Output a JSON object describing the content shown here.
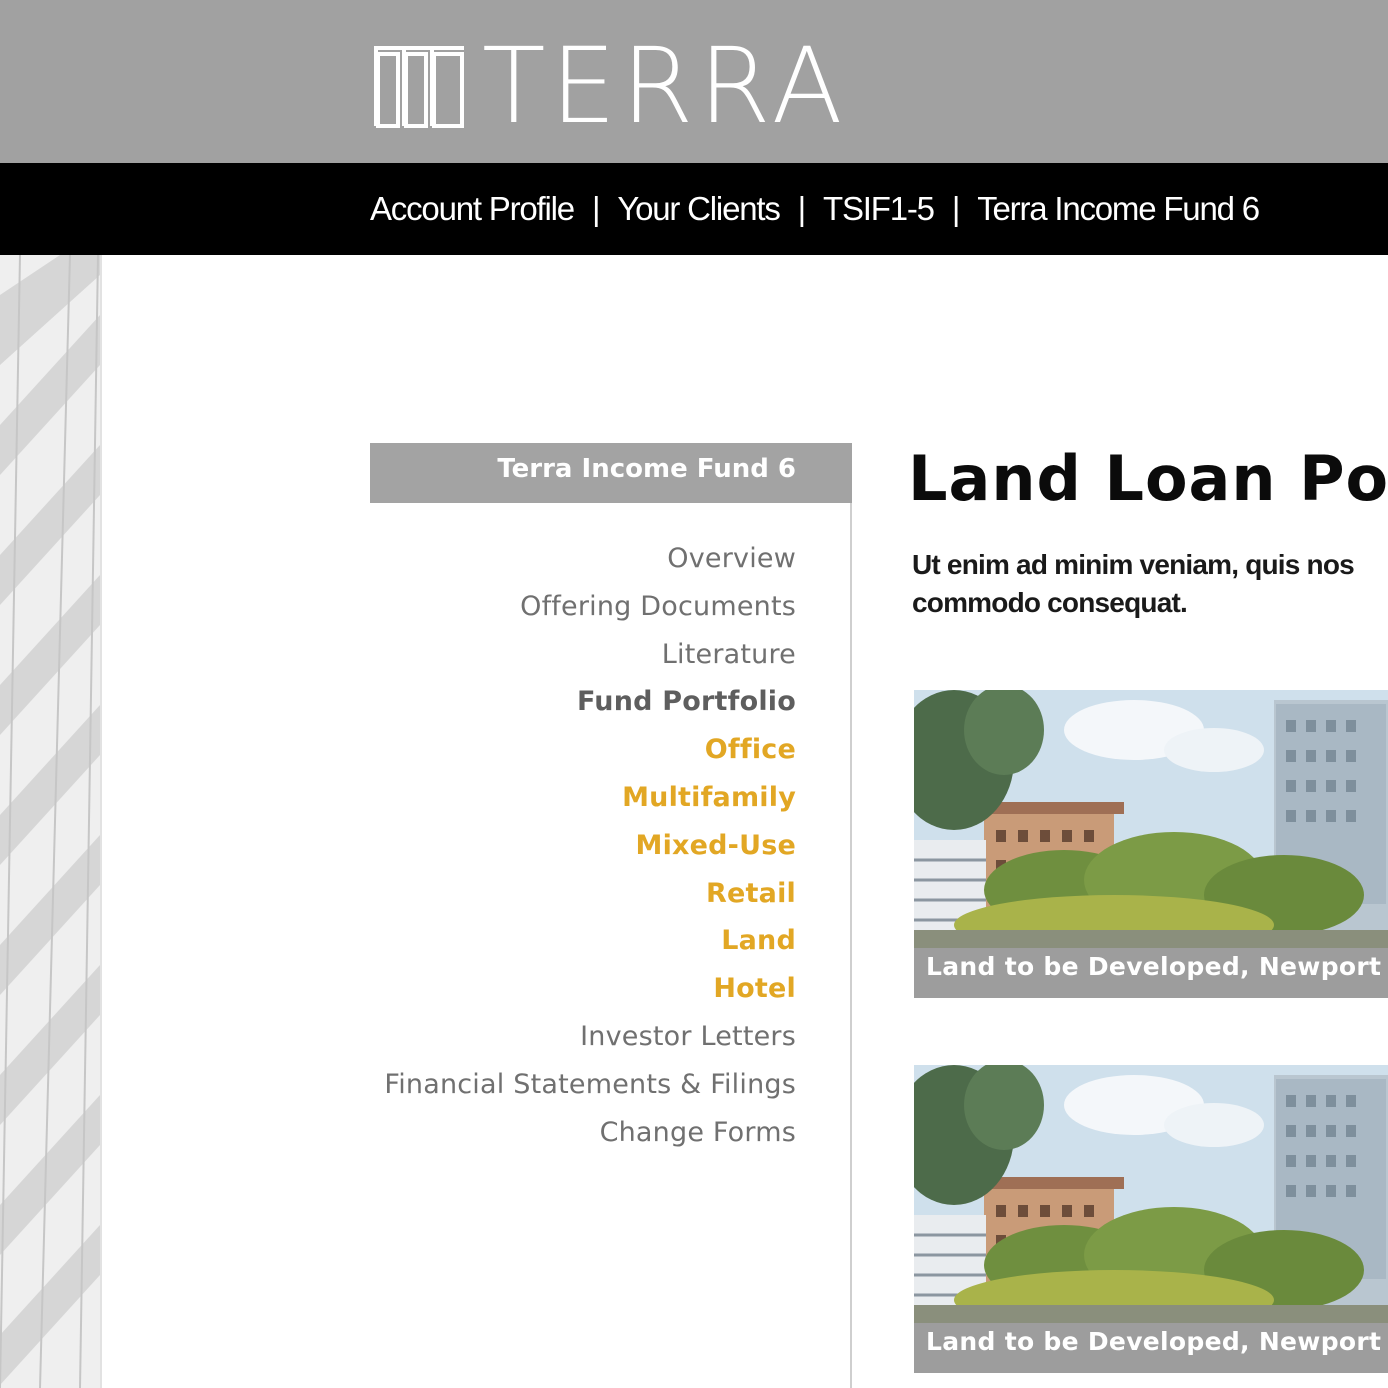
{
  "brand": {
    "name": "TERRA"
  },
  "topnav": {
    "items": [
      "Account Profile",
      "Your Clients",
      "TSIF1-5",
      "Terra Income Fund 6"
    ],
    "separator": "|"
  },
  "sidebar": {
    "header": "Terra Income Fund 6",
    "items": [
      {
        "label": "Overview",
        "style": "normal"
      },
      {
        "label": "Offering Documents",
        "style": "normal"
      },
      {
        "label": "Literature",
        "style": "normal"
      },
      {
        "label": "Fund Portfolio",
        "style": "bold"
      },
      {
        "label": "Office",
        "style": "sub"
      },
      {
        "label": "Multifamily",
        "style": "sub"
      },
      {
        "label": "Mixed-Use",
        "style": "sub"
      },
      {
        "label": "Retail",
        "style": "sub"
      },
      {
        "label": "Land",
        "style": "sub"
      },
      {
        "label": "Hotel",
        "style": "sub"
      },
      {
        "label": "Investor Letters",
        "style": "normal"
      },
      {
        "label": "Financial Statements & Filings",
        "style": "normal"
      },
      {
        "label": "Change Forms",
        "style": "normal"
      }
    ]
  },
  "main": {
    "title": "Land Loan Port",
    "intro_line1": "Ut enim ad minim veniam, quis nos",
    "intro_line2": "commodo consequat.",
    "cards": [
      {
        "caption": "Land to be Developed, Newport Be"
      },
      {
        "caption": "Land to be Developed, Newport Be"
      }
    ]
  },
  "colors": {
    "header_bg": "#a1a1a1",
    "nav_bg": "#000000",
    "accent_gold": "#e2a724",
    "menu_gray": "#707070"
  }
}
